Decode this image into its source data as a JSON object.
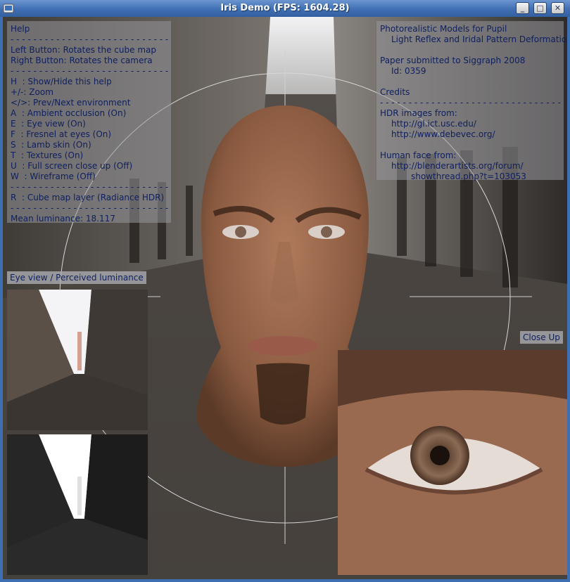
{
  "window": {
    "title": "Iris Demo  (FPS: 1604.28)",
    "controls": {
      "minimize": "_",
      "maximize": "□",
      "close": "✕"
    }
  },
  "help_panel": {
    "lines": [
      "Help",
      "---",
      "Left Button: Rotates the cube map",
      "Right Button: Rotates the camera",
      "---",
      "H  : Show/Hide this help",
      "+/-: Zoom",
      "</>: Prev/Next environment",
      "A  : Ambient occlusion (On)",
      "E  : Eye view (On)",
      "F  : Fresnel at eyes (On)",
      "S  : Lamb skin (On)",
      "T  : Textures (On)",
      "U  : Full screen close up (Off)",
      "W  : Wireframe (Off)",
      "---",
      "R  : Cube map layer (Radiance HDR)",
      "---",
      "Mean luminance: 18.117"
    ],
    "separator": "- - - - - - - - - - - - - - - - - - - - - - - - - - - - - - - - - - - -"
  },
  "credits_panel": {
    "title_line1": "Photorealistic Models for Pupil",
    "title_line2": "Light Reflex and Iridal Pattern Deformation",
    "paper": "Paper submitted to Siggraph 2008",
    "paper_id": "Id: 0359",
    "credits": "Credits",
    "hdr_label": "HDR images from:",
    "hdr_url1": "http://gl.ict.usc.edu/",
    "hdr_url2": "http://www.debevec.org/",
    "face_label": "Human face from:",
    "face_url1": "http://blenderartists.org/forum/",
    "face_url2": "showthread.php?t=103053",
    "separator": "- - - - - - - - - - - - - - - - - - - - - - - - - - - - - - - - - - - - -"
  },
  "eye_view_label": "Eye view / Perceived luminance",
  "close_up_label": "Close Up"
}
